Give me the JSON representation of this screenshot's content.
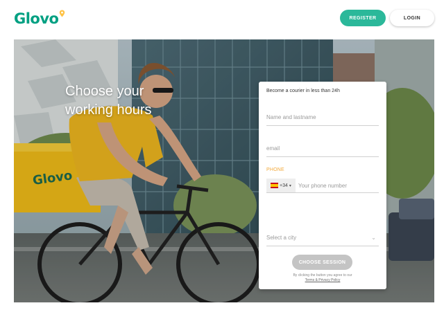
{
  "header": {
    "logo_text": "Glovo",
    "register_label": "REGISTER",
    "login_label": "LOGIN",
    "brand_color": "#00a082",
    "pin_color": "#ffc244"
  },
  "hero": {
    "title_line1": "Choose your",
    "title_line2": "working hours"
  },
  "form": {
    "heading": "Become a courier in less than 24h",
    "name_placeholder": "Name and lastname",
    "email_placeholder": "email",
    "phone_label": "PHONE",
    "country_code": "+34",
    "country_flag_icon": "spain-flag-icon",
    "phone_placeholder": "Your phone number",
    "city_placeholder": "Select a city",
    "submit_label": "CHOOSE SESSION",
    "terms_text": "By clicking the button you agree to our",
    "terms_link": "Terms & Privacy Policy",
    "phone_label_color": "#f2a93b",
    "submit_color": "#c4c4c4"
  }
}
